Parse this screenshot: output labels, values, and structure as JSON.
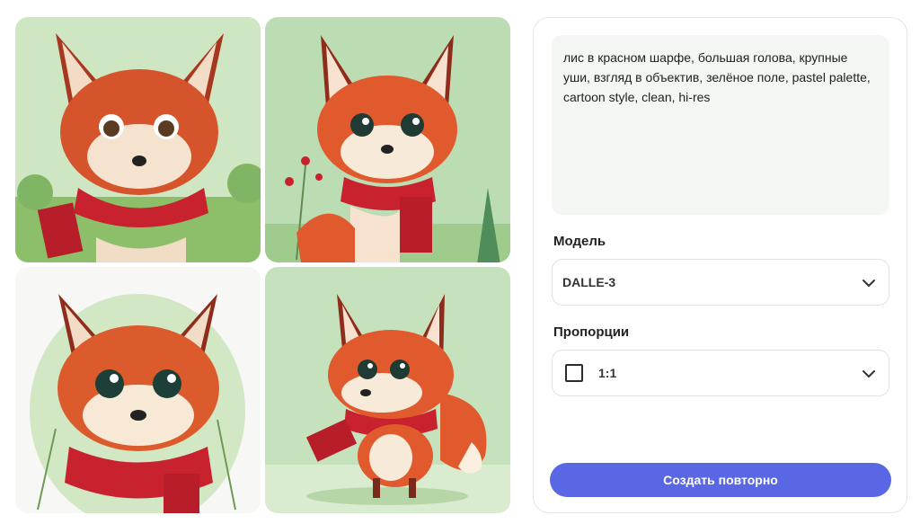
{
  "gallery": {
    "images": [
      {
        "name": "fox-image-1"
      },
      {
        "name": "fox-image-2"
      },
      {
        "name": "fox-image-3"
      },
      {
        "name": "fox-image-4"
      }
    ]
  },
  "settings": {
    "prompt": "лис в красном шарфе, большая голова, крупные уши, взгляд в объектив, зелёное поле, pastel palette, cartoon style, clean, hi-res",
    "model_label": "Модель",
    "model_value": "DALLE-3",
    "ratio_label": "Пропорции",
    "ratio_value": "1:1",
    "regenerate_label": "Создать повторно",
    "icons": {
      "dropdown": "chevron-down-icon",
      "ratio": "square-ratio-icon"
    }
  },
  "colors": {
    "accent": "#5a67e4",
    "prompt_bg": "#f3f6f3",
    "border": "#e3e6e8"
  }
}
